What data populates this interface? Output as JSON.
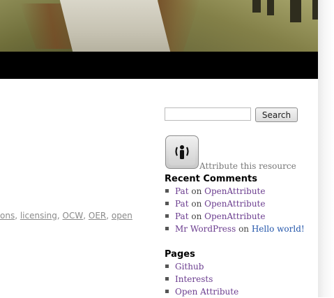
{
  "tags": {
    "items": [
      {
        "label": "ons"
      },
      {
        "label": "licensing"
      },
      {
        "label": "OCW"
      },
      {
        "label": "OER"
      },
      {
        "label": "open"
      }
    ]
  },
  "search": {
    "value": "",
    "placeholder": "",
    "button_label": "Search"
  },
  "attribute": {
    "icon": "person-broadcast-icon",
    "text": "Attribute this resource"
  },
  "recent_comments": {
    "title": "Recent Comments",
    "items": [
      {
        "author": "Pat",
        "joiner": "on",
        "post": "OpenAttribute"
      },
      {
        "author": "Pat",
        "joiner": "on",
        "post": "OpenAttribute"
      },
      {
        "author": "Pat",
        "joiner": "on",
        "post": "OpenAttribute"
      },
      {
        "author": "Mr WordPress",
        "joiner": "on",
        "post": "Hello world!"
      }
    ]
  },
  "pages": {
    "title": "Pages",
    "items": [
      {
        "label": "Github"
      },
      {
        "label": "Interests"
      },
      {
        "label": "Open Attribute"
      }
    ]
  },
  "colors": {
    "link_visited": "#6b3d8f",
    "link": "#2255aa",
    "header_bar": "#000000"
  }
}
